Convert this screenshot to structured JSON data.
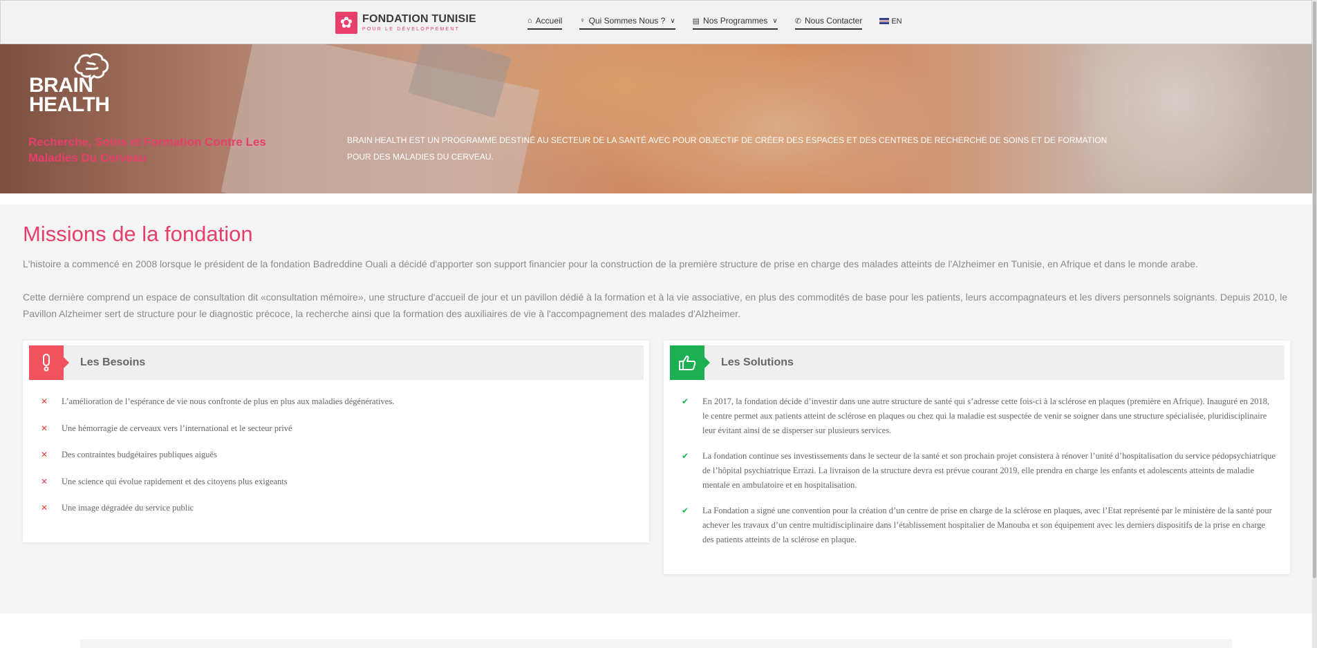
{
  "header": {
    "logo": {
      "title": "FONDATION TUNISIE",
      "subtitle": "POUR LE DÉVELOPPEMENT",
      "icon": "flower-icon"
    },
    "nav": [
      {
        "label": "Accueil",
        "icon": "home-icon",
        "has_dropdown": false
      },
      {
        "label": "Qui Sommes Nous ?",
        "icon": "bulb-icon",
        "has_dropdown": true
      },
      {
        "label": "Nos Programmes",
        "icon": "list-icon",
        "has_dropdown": true
      },
      {
        "label": "Nous Contacter",
        "icon": "phone-icon",
        "has_dropdown": false
      }
    ],
    "language": {
      "label": "EN",
      "icon": "uk-flag-icon"
    }
  },
  "hero": {
    "logo_lines": [
      "BRAIN",
      "HEALTH"
    ],
    "logo_icon": "brain-icon",
    "tagline": "Recherche, Soins et Formation Contre Les Maladies Du Cerveau",
    "description": "BRAIN HEALTH EST UN PROGRAMME DESTINÉ AU SECTEUR DE LA SANTÉ AVEC POUR OBJECTIF DE CRÉER DES ESPACES ET DES CENTRES DE RECHERCHE DE SOINS ET DE FORMATION POUR DES MALADIES DU CERVEAU."
  },
  "missions": {
    "title": "Missions de la fondation",
    "paragraph1": "L'histoire a commencé en 2008 lorsque le président de la fondation Badreddine Ouali a décidé d'apporter son support financier pour la construction de la première structure de prise en charge des malades atteints de l'Alzheimer en Tunisie, en Afrique et dans le monde arabe.",
    "paragraph2": " Cette dernière comprend un espace de consultation dit «consultation mémoire», une structure d'accueil de jour et un pavillon dédié à la formation et à la vie associative, en plus des commodités de base pour les patients, leurs accompagnateurs et les divers personnels soignants. Depuis 2010, le Pavillon Alzheimer sert de structure pour le diagnostic précoce, la recherche ainsi que la formation des auxiliaires de vie à l'accompagnement des malades d'Alzheimer."
  },
  "besoins": {
    "title": "Les Besoins",
    "icon": "exclamation-icon",
    "items": [
      "L’amélioration de l’espérance de vie nous confronte de plus en plus aux maladies dégénératives.",
      "Une hémorragie de cerveaux vers l’international et le secteur privé",
      "Des contraintes budgétaires publiques aiguës",
      "Une science qui évolue rapidement et des citoyens plus exigeants",
      "Une image dégradée du service public"
    ]
  },
  "solutions": {
    "title": "Les Solutions",
    "icon": "thumbs-up-icon",
    "items": [
      "En 2017, la fondation décide d’investir dans une autre structure de santé qui s’adresse cette fois-ci à la sclérose en plaques (première en Afrique). Inauguré en 2018, le centre permet aux patients atteint de sclérose en plaques ou chez qui la maladie est suspectée de venir se soigner dans une structure spécialisée, pluridisciplinaire leur évitant ainsi de se disperser sur plusieurs services.",
      "La fondation continue ses investissements dans le secteur de la santé et son prochain projet consistera à rénover l’unité d’hospitalisation du service pédopsychiatrique de l’hôpital psychiatrique Errazi. La livraison de la structure devra est prévue courant 2019, elle prendra en charge les enfants et adolescents atteints de maladie mentale en ambulatoire et en hospitalisation.",
      "La Fondation a signé une convention pour la création d’un centre de prise en charge de la sclérose en plaques, avec l’Etat représenté par le ministère de la santé pour achever les travaux d’un centre multidisciplinaire dans l’établissement hospitalier de Manouba et son équipement avec les derniers dispositifs de la prise en charge des patients atteints de la sclérose en plaque."
    ]
  },
  "colors": {
    "accent": "#e83e6c",
    "red": "#f0525e",
    "green": "#1db052"
  }
}
